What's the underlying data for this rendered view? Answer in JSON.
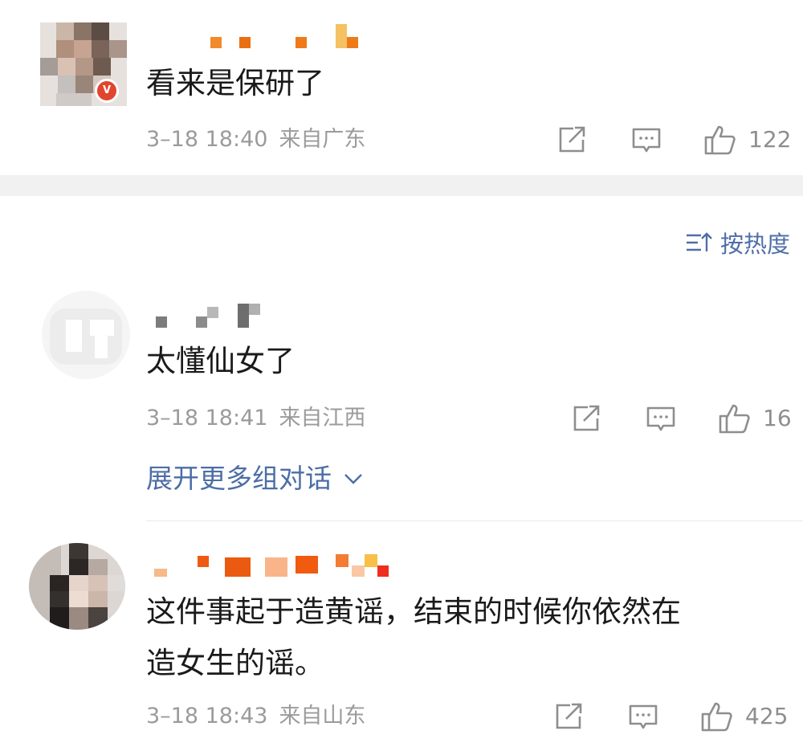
{
  "colors": {
    "link": "#4c6ea6",
    "meta": "#9b9b9b",
    "text": "#1a1a1a",
    "username_mask": "#f07a1a",
    "verified_badge": "#e2452f"
  },
  "sort": {
    "label": "按热度",
    "icon": "sort-icon"
  },
  "comments": [
    {
      "text_lines": [
        "看来是保研了"
      ],
      "date": "3–18 18:40",
      "location": "来自广东",
      "likes": "122",
      "verified": true
    },
    {
      "text_lines": [
        "太懂仙女了"
      ],
      "date": "3–18 18:41",
      "location": "来自江西",
      "likes": "16",
      "verified": false,
      "expand_label": "展开更多组对话"
    },
    {
      "text_lines": [
        "这件事起于造黄谣，结束的时候你依然在",
        "造女生的谣。"
      ],
      "date": "3–18 18:43",
      "location": "来自山东",
      "likes": "425",
      "verified": false
    }
  ],
  "icons": {
    "share": "share-icon",
    "comment": "comment-icon",
    "like": "thumbs-up-icon",
    "expand": "chevron-down-icon"
  }
}
